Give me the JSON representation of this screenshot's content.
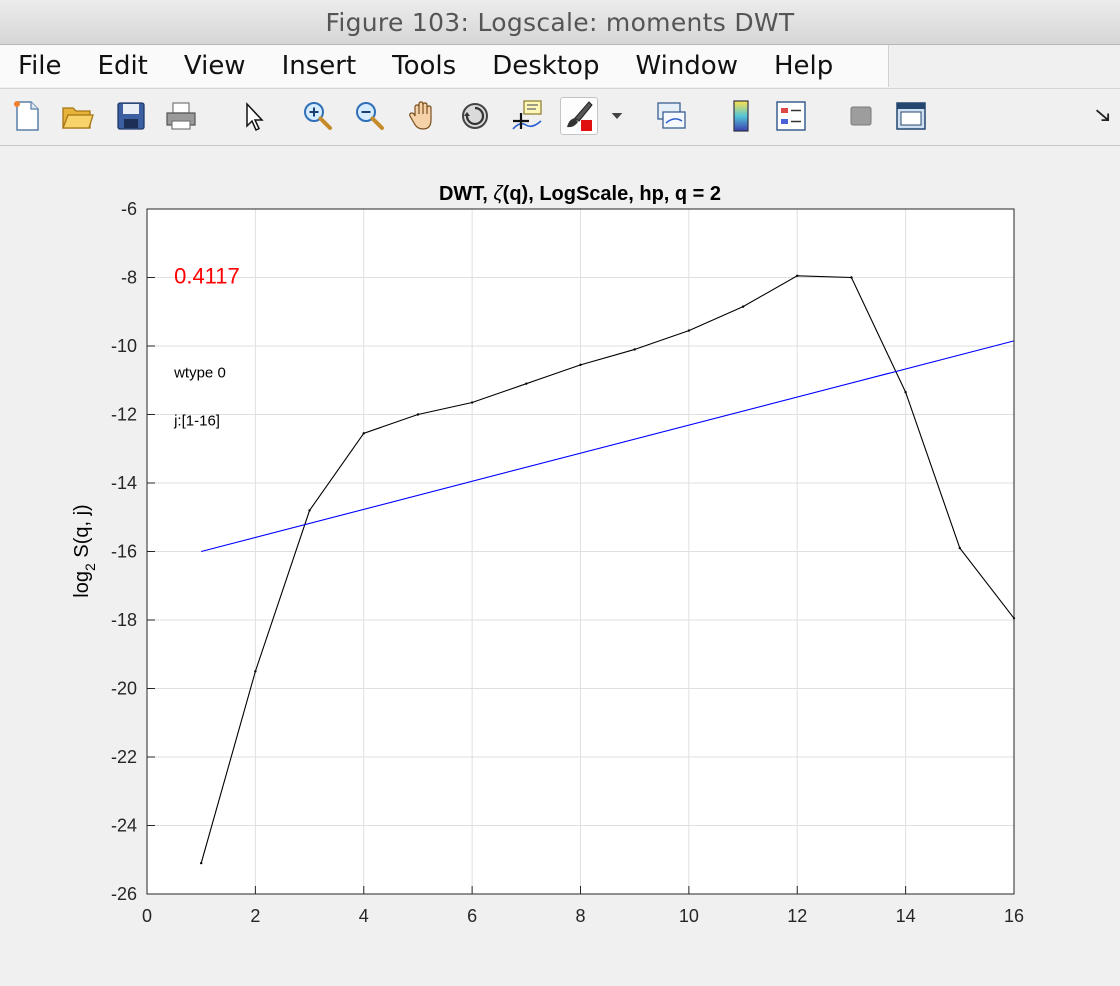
{
  "window": {
    "title": "Figure 103: Logscale: moments DWT"
  },
  "menubar": {
    "items": [
      "File",
      "Edit",
      "View",
      "Insert",
      "Tools",
      "Desktop",
      "Window",
      "Help"
    ]
  },
  "toolbar": {
    "icons": [
      "new-figure-icon",
      "open-file-icon",
      "save-icon",
      "print-icon",
      "edit-plot-cursor-icon",
      "zoom-in-icon",
      "zoom-out-icon",
      "pan-hand-icon",
      "rotate-3d-icon",
      "data-cursor-icon",
      "brush-icon",
      "brush-dropdown-icon",
      "link-plot-icon",
      "colorbar-icon",
      "legend-icon",
      "hide-plot-tools-icon",
      "show-plot-tools-icon",
      "dock-arrow-icon"
    ]
  },
  "chart_data": {
    "type": "line",
    "title_parts": {
      "before": "DWT, ",
      "symbol": "ζ",
      "after": "(q), LogScale, hp, q = 2"
    },
    "xlabel": "",
    "ylabel": {
      "base": "log",
      "subscript": "2",
      "rest": " S(q, j)"
    },
    "xlim": [
      0,
      16
    ],
    "ylim": [
      -26,
      -6
    ],
    "xticks": [
      0,
      2,
      4,
      6,
      8,
      10,
      12,
      14,
      16
    ],
    "yticks": [
      -26,
      -24,
      -22,
      -20,
      -18,
      -16,
      -14,
      -12,
      -10,
      -8,
      -6
    ],
    "grid": true,
    "series": [
      {
        "color": "#000000",
        "x": [
          1,
          2,
          3,
          4,
          5,
          6,
          7,
          8,
          9,
          10,
          11,
          12,
          13,
          14,
          15,
          16
        ],
        "y": [
          -25.1,
          -19.5,
          -14.8,
          -12.55,
          -12.0,
          -11.65,
          -11.1,
          -10.55,
          -10.1,
          -9.55,
          -8.85,
          -7.95,
          -8.0,
          -11.35,
          -15.9,
          -17.95
        ]
      },
      {
        "color": "#0000ff",
        "x": [
          1,
          16
        ],
        "y": [
          -16.0,
          -9.85
        ]
      }
    ],
    "annotations": [
      {
        "text": "0.4117",
        "x": 0.5,
        "y": -8.0,
        "color": "#ff0000"
      },
      {
        "text": "wtype 0",
        "x": 0.5,
        "y": -10.8,
        "color": "#000000"
      },
      {
        "text": "j:[1-16]",
        "x": 0.5,
        "y": -12.2,
        "color": "#000000"
      }
    ]
  }
}
